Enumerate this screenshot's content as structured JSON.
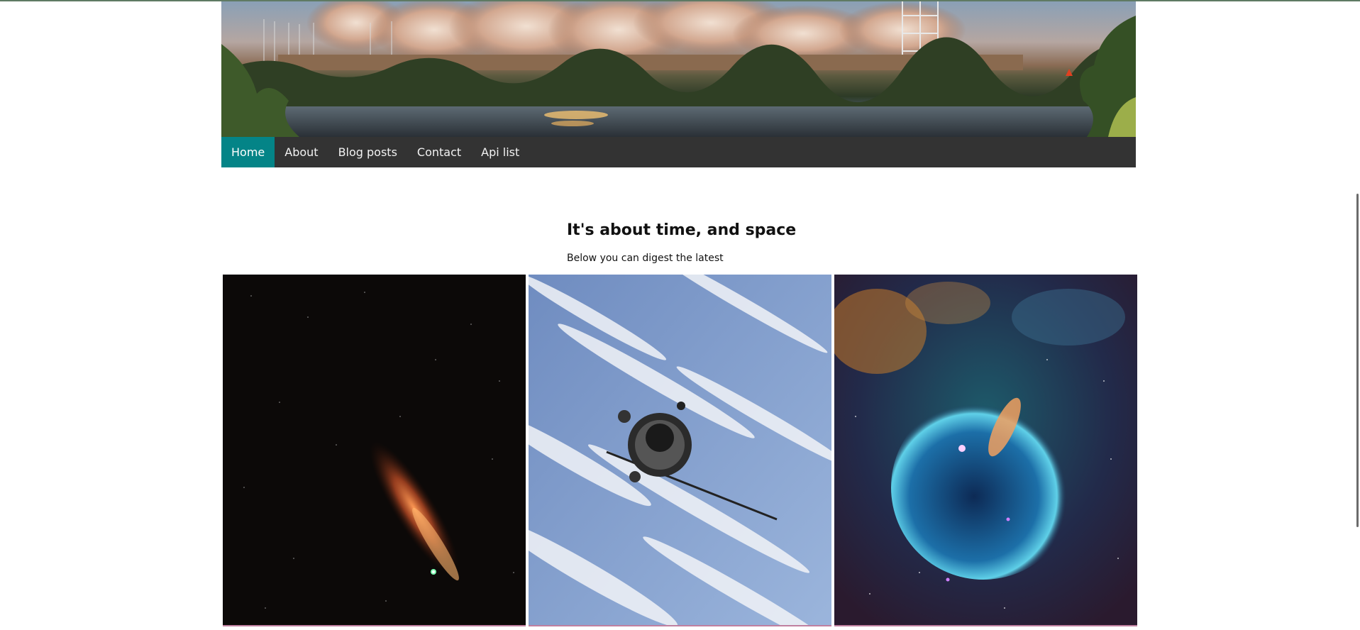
{
  "nav": {
    "items": [
      {
        "label": "Home",
        "active": true
      },
      {
        "label": "About",
        "active": false
      },
      {
        "label": "Blog posts",
        "active": false
      },
      {
        "label": "Contact",
        "active": false
      },
      {
        "label": "Api list",
        "active": false
      }
    ]
  },
  "hero": {
    "title": "It's about time, and space",
    "subtitle": "Below you can digest the latest"
  },
  "colors": {
    "nav_background": "#333333",
    "nav_active": "#048487",
    "nav_text": "#f2f2f2"
  },
  "gallery": {
    "images": [
      {
        "icon": "comet-image"
      },
      {
        "icon": "satellite-image"
      },
      {
        "icon": "nebula-image"
      }
    ]
  }
}
